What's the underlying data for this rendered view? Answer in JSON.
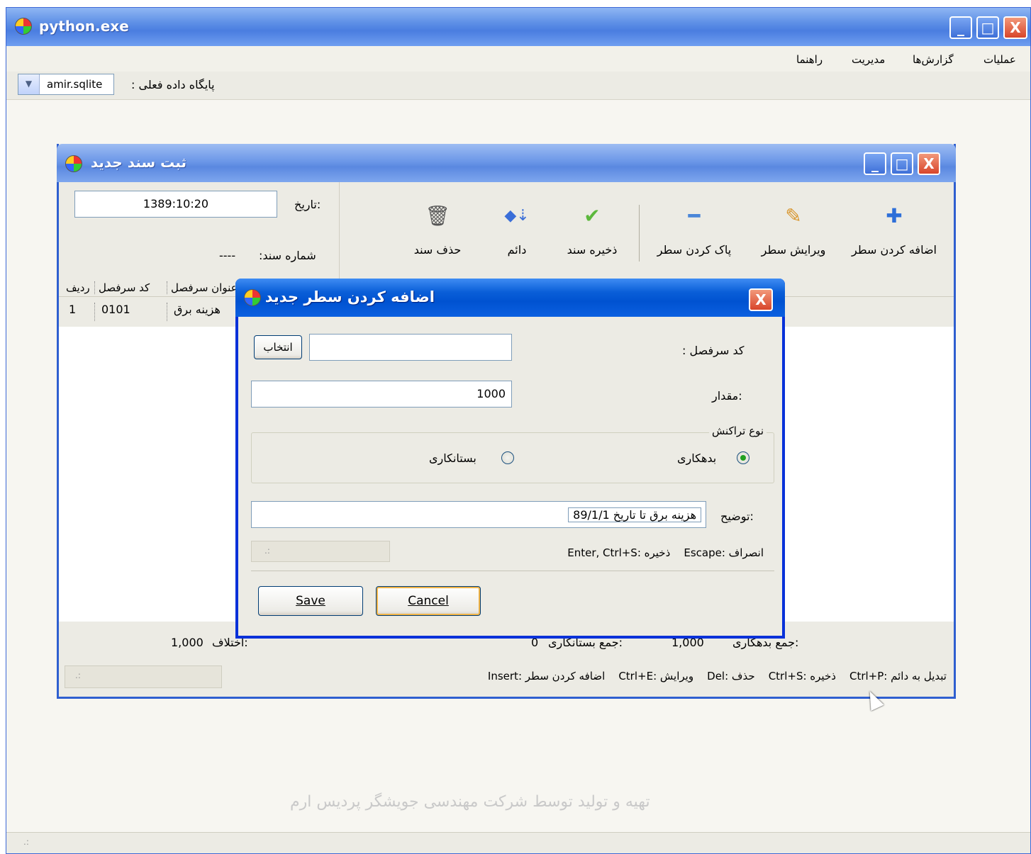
{
  "main_window": {
    "title": "python.exe",
    "controls": {
      "min": "_",
      "max": "□",
      "close": "X"
    }
  },
  "menu": {
    "items": [
      "عملیات",
      "گزارش‌ها",
      "مدیریت",
      "راهنما"
    ]
  },
  "db": {
    "label": "پایگاه داده فعلی :",
    "value": "amir.sqlite"
  },
  "watermark": "تهیه و تولید توسط شرکت مهندسی جویشگر پردیس ارم",
  "doc_window": {
    "title": "ثبت سند جدید",
    "date_label": "تاریخ:",
    "date_value": "1389:10:20",
    "number_label": "شماره سند:",
    "number_value": "----",
    "toolbar": {
      "add_row": "اضافه کردن سطر",
      "edit_row": "ویرایش سطر",
      "delete_row": "پاک کردن سطر",
      "save_doc": "ذخیره سند",
      "permanent": "دائم",
      "delete_doc": "حذف سند"
    },
    "grid": {
      "headers": {
        "row": "ردیف",
        "code": "کد سرفصل",
        "title": "عنوان سرفصل"
      },
      "rows": [
        {
          "row": "1",
          "code": "0101",
          "title": "هزینه برق"
        }
      ]
    },
    "totals": {
      "debit_label": "جمع بدهکاری:",
      "debit_value": "1,000",
      "credit_label": "جمع بستانکاری:",
      "credit_value": "0",
      "diff_label": "اختلاف:",
      "diff_value": "1,000"
    },
    "shortcuts": "تبدیل به دائم :Ctrl+P    ذخیره :Ctrl+S    حذف :Del    ویرایش :Ctrl+E    اضافه کردن سطر :Insert"
  },
  "dialog": {
    "title": "اضافه کردن سطر جدید",
    "code_label": "کد سرفصل :",
    "code_value": "",
    "select_button": "انتخاب",
    "amount_label": "مقدار:",
    "amount_value": "1000",
    "type_group": "نوع تراکنش",
    "debit_option": "بدهکاری",
    "credit_option": "بستانکاری",
    "selected_type": "debit",
    "desc_label": "توضیح:",
    "desc_value": "هزینه برق تا تاریخ 89/1/1",
    "hint": "انصراف :Escape    ذخیره :Enter, Ctrl+S",
    "save_button": "Save",
    "cancel_button": "Cancel"
  }
}
